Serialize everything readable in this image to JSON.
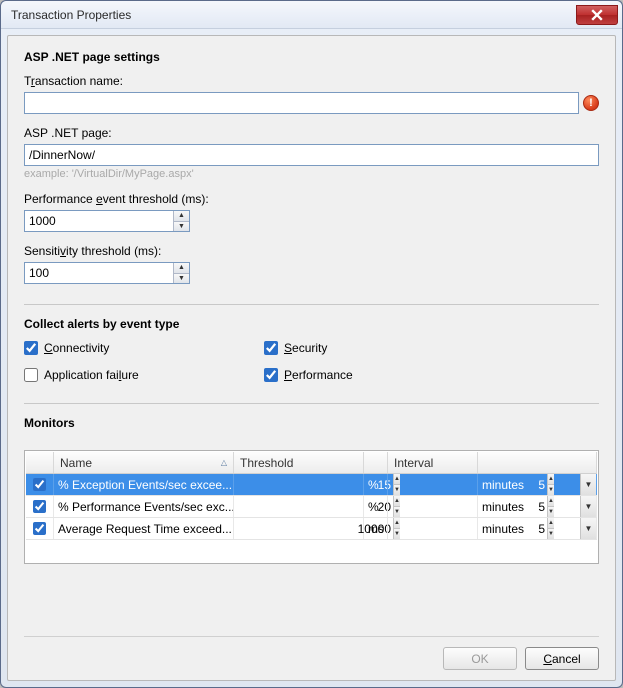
{
  "window": {
    "title": "Transaction Properties"
  },
  "sections": {
    "page_settings_title": "ASP .NET page settings",
    "collect_alerts_title": "Collect alerts by event type",
    "monitors_title": "Monitors"
  },
  "fields": {
    "transaction_name": {
      "label_pre": "T",
      "label_ul": "r",
      "label_post": "ansaction name:",
      "value": ""
    },
    "asp_page": {
      "label_pre": "ASP .NET pa",
      "label_ul": "g",
      "label_post": "e:",
      "value": "/DinnerNow/",
      "hint": "example: '/VirtualDir/MyPage.aspx'"
    },
    "perf_threshold": {
      "label_pre": "Performance ",
      "label_ul": "e",
      "label_post": "vent threshold (ms):",
      "value": "1000"
    },
    "sensitivity": {
      "label_pre": "Sensiti",
      "label_ul": "v",
      "label_post": "ity threshold (ms):",
      "value": "100"
    }
  },
  "alerts": {
    "connectivity": {
      "label_ul": "C",
      "label_post": "onnectivity",
      "checked": true
    },
    "security": {
      "label_ul": "S",
      "label_post": "ecurity",
      "checked": true
    },
    "app_failure": {
      "label_pre": "Application fai",
      "label_ul": "l",
      "label_post": "ure",
      "checked": false
    },
    "performance": {
      "label_ul": "P",
      "label_post": "erformance",
      "checked": true
    }
  },
  "monitors": {
    "headers": {
      "name": "Name",
      "threshold": "Threshold",
      "interval": "Interval"
    },
    "rows": [
      {
        "checked": true,
        "name": "% Exception Events/sec excee...",
        "threshold": "15",
        "unit": "%",
        "interval": "5",
        "interval_unit": "minutes",
        "selected": true
      },
      {
        "checked": true,
        "name": "% Performance Events/sec exc...",
        "threshold": "20",
        "unit": "%",
        "interval": "5",
        "interval_unit": "minutes",
        "selected": false
      },
      {
        "checked": true,
        "name": "Average Request Time exceed...",
        "threshold": "10000",
        "unit": "ms",
        "interval": "5",
        "interval_unit": "minutes",
        "selected": false
      }
    ]
  },
  "buttons": {
    "ok": "OK",
    "cancel_ul": "C",
    "cancel_post": "ancel"
  }
}
